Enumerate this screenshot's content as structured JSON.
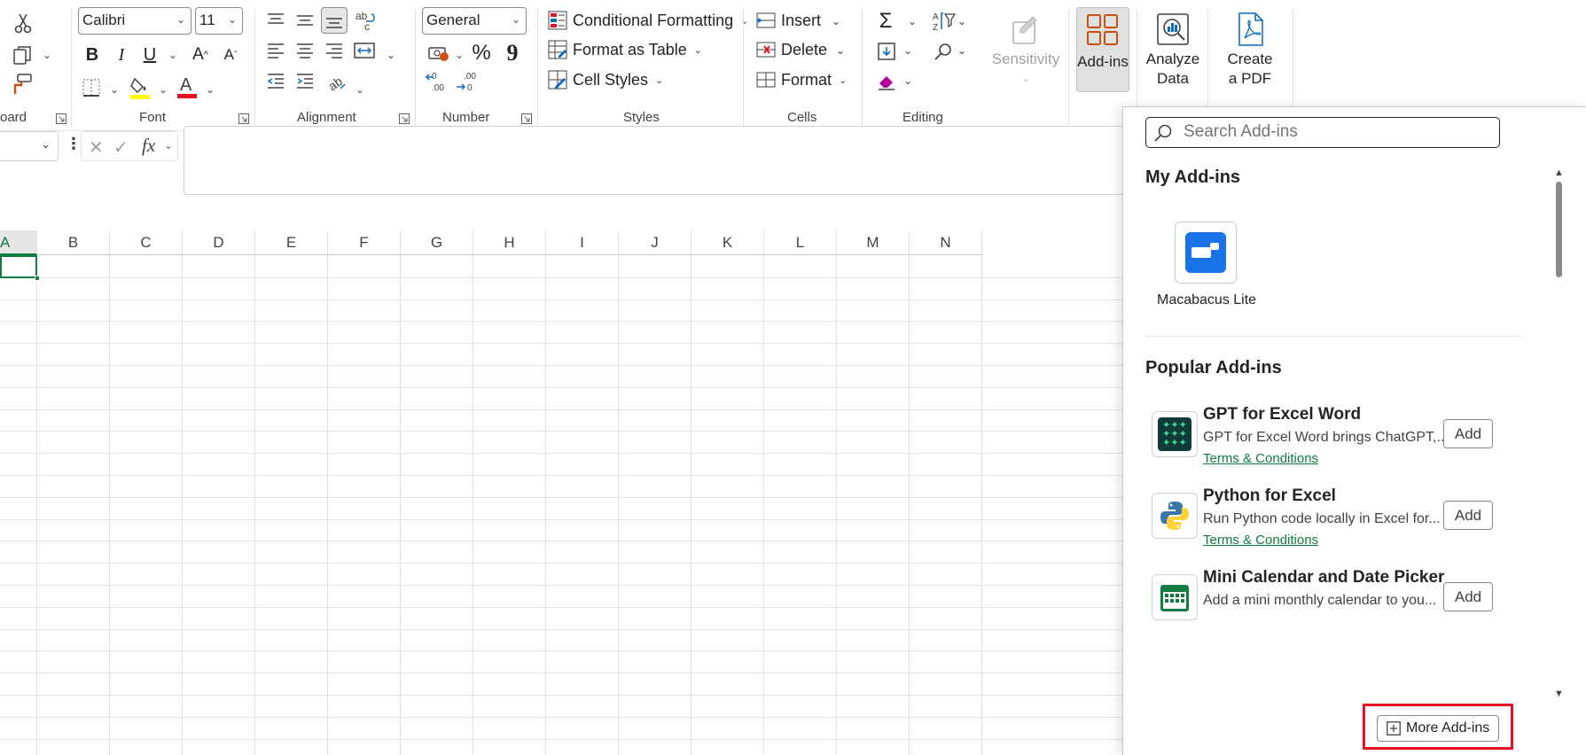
{
  "ribbon": {
    "clipboard": {
      "label": "oard"
    },
    "font": {
      "label": "Font",
      "font_name": "Calibri",
      "font_size": "11",
      "bold": "B",
      "italic": "I",
      "underline": "U",
      "highlight_color": "#ffff00",
      "font_color": "#e81123"
    },
    "alignment": {
      "label": "Alignment"
    },
    "number": {
      "label": "Number",
      "format": "General",
      "percent": "%",
      "comma": "9"
    },
    "styles": {
      "label": "Styles",
      "conditional_formatting": "Conditional Formatting",
      "format_as_table": "Format as Table",
      "cell_styles": "Cell Styles"
    },
    "cells": {
      "label": "Cells",
      "insert": "Insert",
      "delete": "Delete",
      "format": "Format"
    },
    "editing": {
      "label": "Editing"
    },
    "sensitivity": "Sensitivity",
    "addins": "Add-ins",
    "analyze_data": [
      "Analyze",
      "Data"
    ],
    "create_pdf": [
      "Create",
      "a PDF"
    ]
  },
  "formula_bar": {
    "fx": "fx"
  },
  "grid": {
    "columns": [
      "A",
      "B",
      "C",
      "D",
      "E",
      "F",
      "G",
      "H",
      "I",
      "J",
      "K",
      "L",
      "M",
      "N"
    ]
  },
  "addins_pane": {
    "search_placeholder": "Search Add-ins",
    "my_addins_title": "My Add-ins",
    "my_addins": [
      {
        "name": "Macabacus Lite"
      }
    ],
    "popular_title": "Popular Add-ins",
    "popular": [
      {
        "name": "GPT for Excel Word",
        "desc": "GPT for Excel Word brings ChatGPT,...",
        "terms": "Terms & Conditions",
        "button": "Add"
      },
      {
        "name": "Python for Excel",
        "desc": "Run Python code locally in Excel for...",
        "terms": "Terms & Conditions",
        "button": "Add"
      },
      {
        "name": "Mini Calendar and Date Picker",
        "desc": "Add a mini monthly calendar to you...",
        "terms": "",
        "button": "Add"
      }
    ],
    "more_button": "More Add-ins",
    "highlight_color": "#e81123"
  }
}
